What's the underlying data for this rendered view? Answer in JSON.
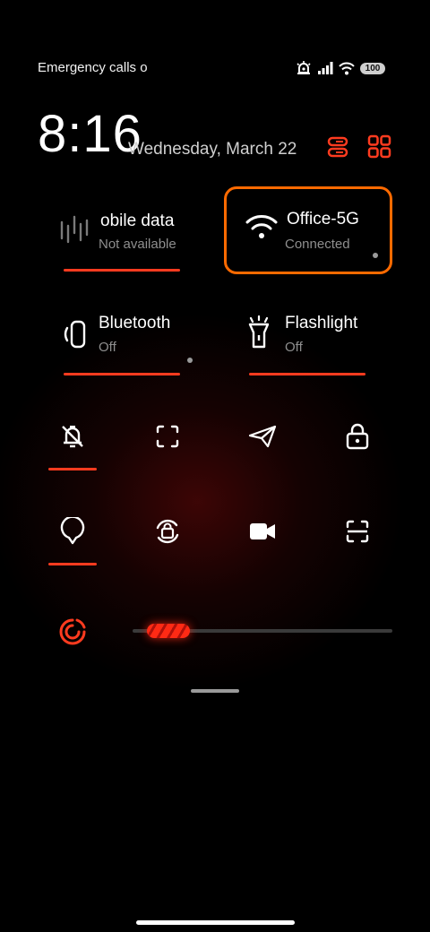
{
  "status_bar": {
    "carrier_text": "Emergency calls o",
    "icons": [
      "alarm-icon",
      "signal-icon",
      "wifi-icon",
      "battery-icon"
    ],
    "battery_level": "100"
  },
  "header": {
    "time": "8:16",
    "date": "Wednesday, March 22",
    "icons": [
      "edit-tiles-icon",
      "grid-icon"
    ]
  },
  "tiles": [
    {
      "title": "obile data",
      "subtitle": "Not available",
      "icon": "mobile-data-icon",
      "active": true
    },
    {
      "title": "Office-5G",
      "subtitle": "Connected",
      "icon": "wifi-icon",
      "active": false,
      "highlighted": true
    },
    {
      "title": "Bluetooth",
      "subtitle": "Off",
      "icon": "bluetooth-icon",
      "active": true
    },
    {
      "title": "Flashlight",
      "subtitle": "Off",
      "icon": "flashlight-icon",
      "active": true
    }
  ],
  "toggles_row1": [
    {
      "icon": "do-not-disturb-icon",
      "active": true
    },
    {
      "icon": "screenshot-icon",
      "active": false
    },
    {
      "icon": "airplane-mode-icon",
      "active": false
    },
    {
      "icon": "lock-screen-icon",
      "active": false
    }
  ],
  "toggles_row2": [
    {
      "icon": "location-icon",
      "active": true
    },
    {
      "icon": "auto-rotate-icon",
      "active": false
    },
    {
      "icon": "screen-record-icon",
      "active": false
    },
    {
      "icon": "scanner-icon",
      "active": false
    }
  ],
  "brightness": {
    "icon": "brightness-icon",
    "level": 0.22
  },
  "accent_color": "#ff3b1f",
  "highlight_color": "#ff6a00"
}
